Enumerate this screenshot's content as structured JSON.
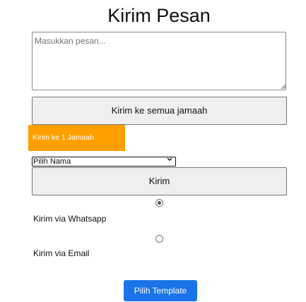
{
  "page": {
    "title": "Kirim Pesan"
  },
  "message": {
    "placeholder": "Masukkan pesan...",
    "value": ""
  },
  "buttons": {
    "send_all": "Kirim ke semua jamaah",
    "send_one_tab": "Kirim ke 1 Jamaah",
    "send": "Kirim",
    "pick_template": "Pilih Template"
  },
  "recipient_select": {
    "selected": "Pilih Nama",
    "options": [
      "Pilih Nama"
    ]
  },
  "channels": {
    "selected": "whatsapp",
    "whatsapp_label": "Kirim via Whatsapp",
    "email_label": "Kirim via Email"
  },
  "colors": {
    "tab_accent": "#ff9f00",
    "primary_button": "#1a73e8",
    "neutral_button": "#efefef"
  },
  "icons": {
    "resize_grip": "resize-grip-icon",
    "select_chevron": "chevron-down-icon"
  }
}
